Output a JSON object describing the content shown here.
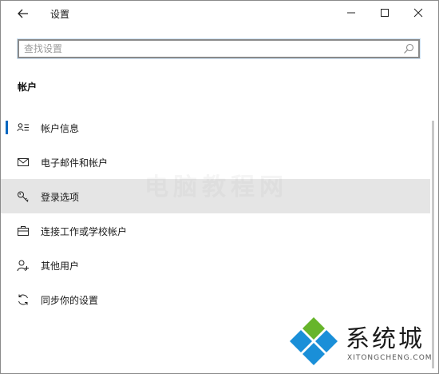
{
  "window": {
    "title": "设置",
    "controls": [
      "minimize-icon",
      "maximize-icon",
      "close-icon"
    ],
    "back_icon": "back-arrow-icon"
  },
  "search": {
    "placeholder": "查找设置",
    "value": "",
    "icon": "search-icon"
  },
  "section": {
    "title": "帐户"
  },
  "nav": {
    "items": [
      {
        "label": "帐户信息",
        "icon": "account-info-icon",
        "selected": true
      },
      {
        "label": "电子邮件和帐户",
        "icon": "mail-icon",
        "selected": false
      },
      {
        "label": "登录选项",
        "icon": "key-icon",
        "selected": false,
        "hover": true
      },
      {
        "label": "连接工作或学校帐户",
        "icon": "briefcase-icon",
        "selected": false
      },
      {
        "label": "其他用户",
        "icon": "add-person-icon",
        "selected": false
      },
      {
        "label": "同步你的设置",
        "icon": "sync-icon",
        "selected": false
      }
    ]
  },
  "watermark": {
    "faint_text": "电脑教程网",
    "brand_name": "系统城",
    "brand_url": "XITONGCHENG.COM"
  },
  "colors": {
    "accent": "#0067c0",
    "hover_bg": "#e5e5e5",
    "logo_blue": "#1a8fd8",
    "logo_green": "#67b52b"
  }
}
